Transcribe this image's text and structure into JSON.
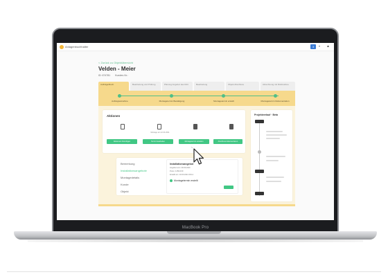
{
  "app": {
    "brand": "Anlagenbuchhalter",
    "notification_badge": "3",
    "user_label": "▲",
    "caret": "▾"
  },
  "page": {
    "back_link": "< Zurück zu Objektübersicht",
    "title": "Velden - Meier",
    "meta": [
      "ID: 674781",
      "Kunden-Nr.: "
    ]
  },
  "tabs": [
    {
      "label": "Aufträge/Rech.",
      "active": true
    },
    {
      "label": "Bearbeitung und Prüfung",
      "active": false
    },
    {
      "label": "Planung Angebot des Dritt",
      "active": false
    },
    {
      "label": "Bearbeitung",
      "active": false
    },
    {
      "label": "Objekt Abschluss",
      "active": false
    },
    {
      "label": "Abrechnung mit Rücknahme",
      "active": false
    }
  ],
  "stepper": [
    "Auftragsannahme",
    "Montagetermin Bestätigung",
    "Montagetermin erstellt",
    "Montagetermin Dokumentation"
  ],
  "aktionen": {
    "title": "Aktionen",
    "items": [
      {
        "icon": "document-icon",
        "sub": "",
        "button": "Dokument hinzufügen"
      },
      {
        "icon": "calendar-icon",
        "sub": "Montage am 12.04.2021",
        "button": "Termin bearbeiten"
      },
      {
        "icon": "file-icon",
        "sub": "",
        "button": "Montagetermin erstellen"
      },
      {
        "icon": "file-icon",
        "sub": "",
        "button": "Abschluss dokumentieren"
      }
    ]
  },
  "lower": {
    "nav": [
      "Bemerkung",
      "Installationsangebote",
      "Montagedetails",
      "Kunde",
      "Objekt"
    ],
    "active_nav": 1,
    "detail": {
      "title": "Installationsangebot",
      "lines": [
        "Angebot vom: 09.03.2021",
        "Preis: 2.450,00 €",
        "Erstellt am: 10.03.2021 09:14"
      ],
      "check_label": "Montagetermin erstellt"
    }
  },
  "timeline": {
    "title": "Projektverlauf · Beta"
  },
  "device": {
    "label": "MacBook Pro"
  },
  "colors": {
    "accent_green": "#41c784",
    "accent_yellow": "#f6d98c",
    "logo_orange": "#f3b73b",
    "bell_blue": "#3a7bd5"
  }
}
